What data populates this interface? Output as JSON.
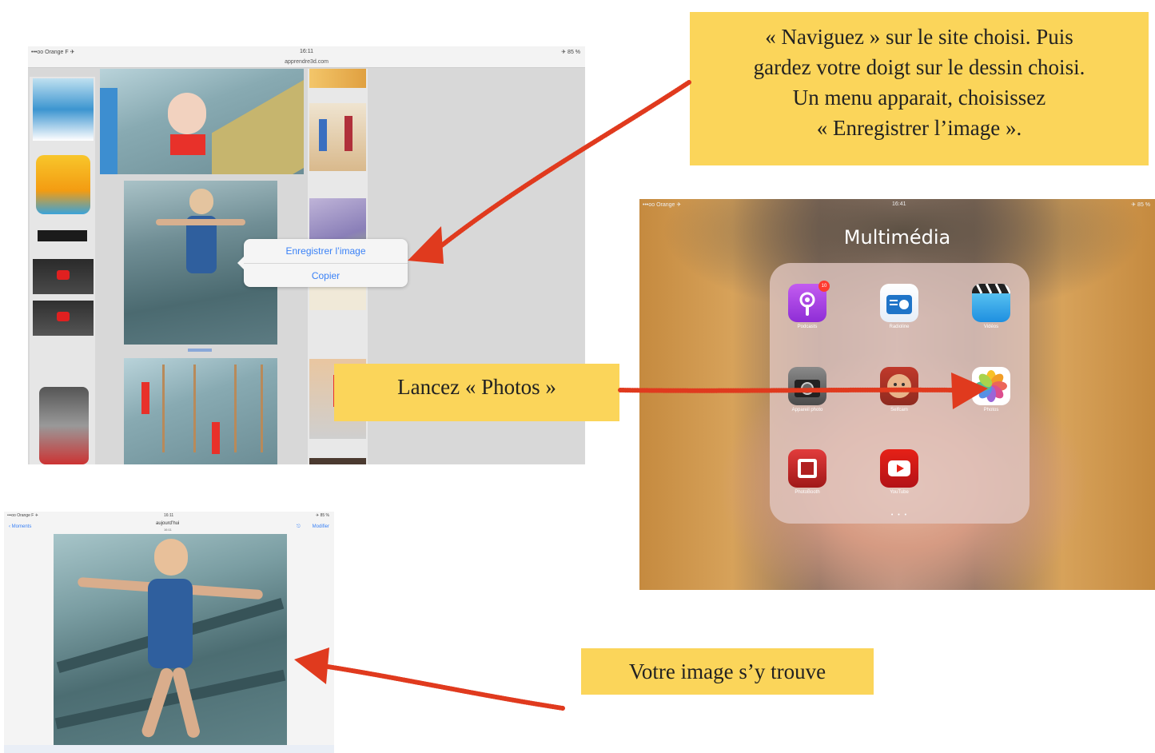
{
  "callouts": {
    "naviguez": [
      "«   Naviguez   » sur le site choisi. Puis",
      "gardez votre doigt sur le dessin choisi.",
      "Un menu apparait, choisissez",
      "«   Enregistrer l’image   »."
    ],
    "lancez": "Lancez «   Photos   »",
    "votre_image": "Votre image s’y trouve"
  },
  "shot1": {
    "status_carrier": "•••oo Orange F ✈",
    "status_time": "16:11",
    "status_battery": "✈ 85 %",
    "url": "apprendre3d.com",
    "context_menu": [
      "Enregistrer l’image",
      "Copier"
    ]
  },
  "shot2": {
    "status_carrier": "•••oo Orange ✈",
    "status_time": "16:41",
    "status_battery": "✈ 85 %",
    "folder_title": "Multimédia",
    "podcasts_badge": "10",
    "apps": [
      {
        "label": "Podcasts",
        "icon": "podcasts-icon"
      },
      {
        "label": "Radioline",
        "icon": "radio-icon"
      },
      {
        "label": "Vidéos",
        "icon": "clapper-icon"
      },
      {
        "label": "Appareil photo",
        "icon": "camera-icon"
      },
      {
        "label": "Selfcam",
        "icon": "selfcam-icon"
      },
      {
        "label": "Photos",
        "icon": "photos-flower-icon"
      },
      {
        "label": "PhotoBooth",
        "icon": "photobooth-icon"
      },
      {
        "label": "YouTube",
        "icon": "youtube-icon"
      }
    ],
    "page_dots": "• • •"
  },
  "shot3": {
    "status_carrier": "•••oo Orange F ✈",
    "status_time": "16:11",
    "status_battery": "✈ 85 %",
    "back_label": "‹ Moments",
    "nav_title": "aujourd’hui",
    "nav_subtitle": "16:11",
    "edit_label": "Modifier"
  },
  "colors": {
    "callout_bg": "#fbd55a",
    "arrow_red": "#e03a1e",
    "ios_blue": "#3b82f6"
  }
}
